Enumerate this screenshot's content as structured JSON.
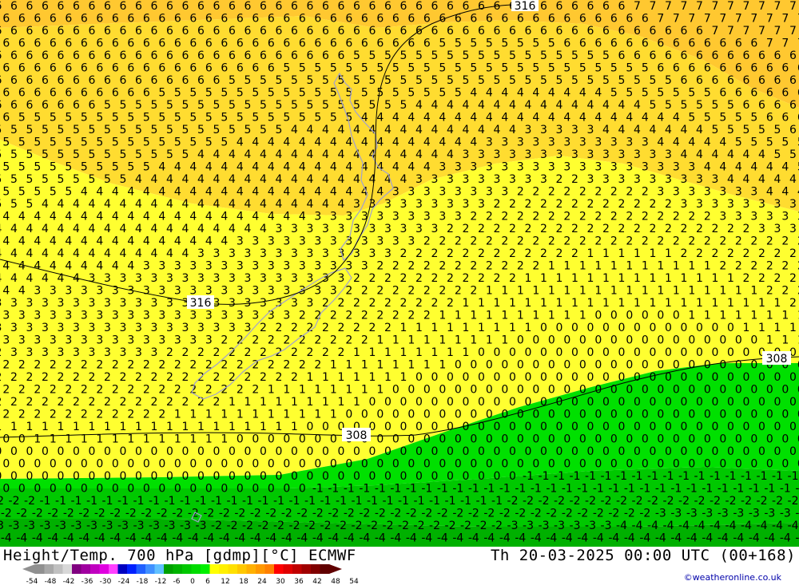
{
  "footer": {
    "title": "Height/Temp. 700 hPa [gdmp][°C] ECMWF",
    "valid_time": "Th 20-03-2025 00:00 UTC (00+168)",
    "credit": "©weatheronline.co.uk"
  },
  "contour_labels": [
    "316",
    "316",
    "308",
    "308"
  ],
  "legend": {
    "ticks": [
      "-54",
      "-48",
      "-42",
      "-36",
      "-30",
      "-24",
      "-18",
      "-12",
      "-6",
      "0",
      "6",
      "12",
      "18",
      "24",
      "30",
      "36",
      "42",
      "48",
      "54"
    ],
    "colors": [
      "#909090",
      "#a8a8a8",
      "#c0c0c0",
      "#d8d8d8",
      "#800080",
      "#a000a0",
      "#c000c0",
      "#e000e0",
      "#ff40ff",
      "#0000c0",
      "#0020ff",
      "#2060ff",
      "#4090ff",
      "#60c0ff",
      "#00a000",
      "#00b400",
      "#00c800",
      "#00dc00",
      "#00f000",
      "#ffff00",
      "#fff000",
      "#ffe000",
      "#ffc800",
      "#ffb000",
      "#ff9800",
      "#ff8000",
      "#ff0000",
      "#e00000",
      "#c00000",
      "#a00000",
      "#800000",
      "#600000"
    ]
  },
  "colors": {
    "temp_6_7": "#ffc830",
    "temp_4_5": "#ffdc30",
    "temp_1_3": "#ffff30",
    "temp_0": "#00e000",
    "temp_neg2": "#00c800",
    "temp_neg4": "#00b000",
    "coast": "#a0a0d0"
  }
}
